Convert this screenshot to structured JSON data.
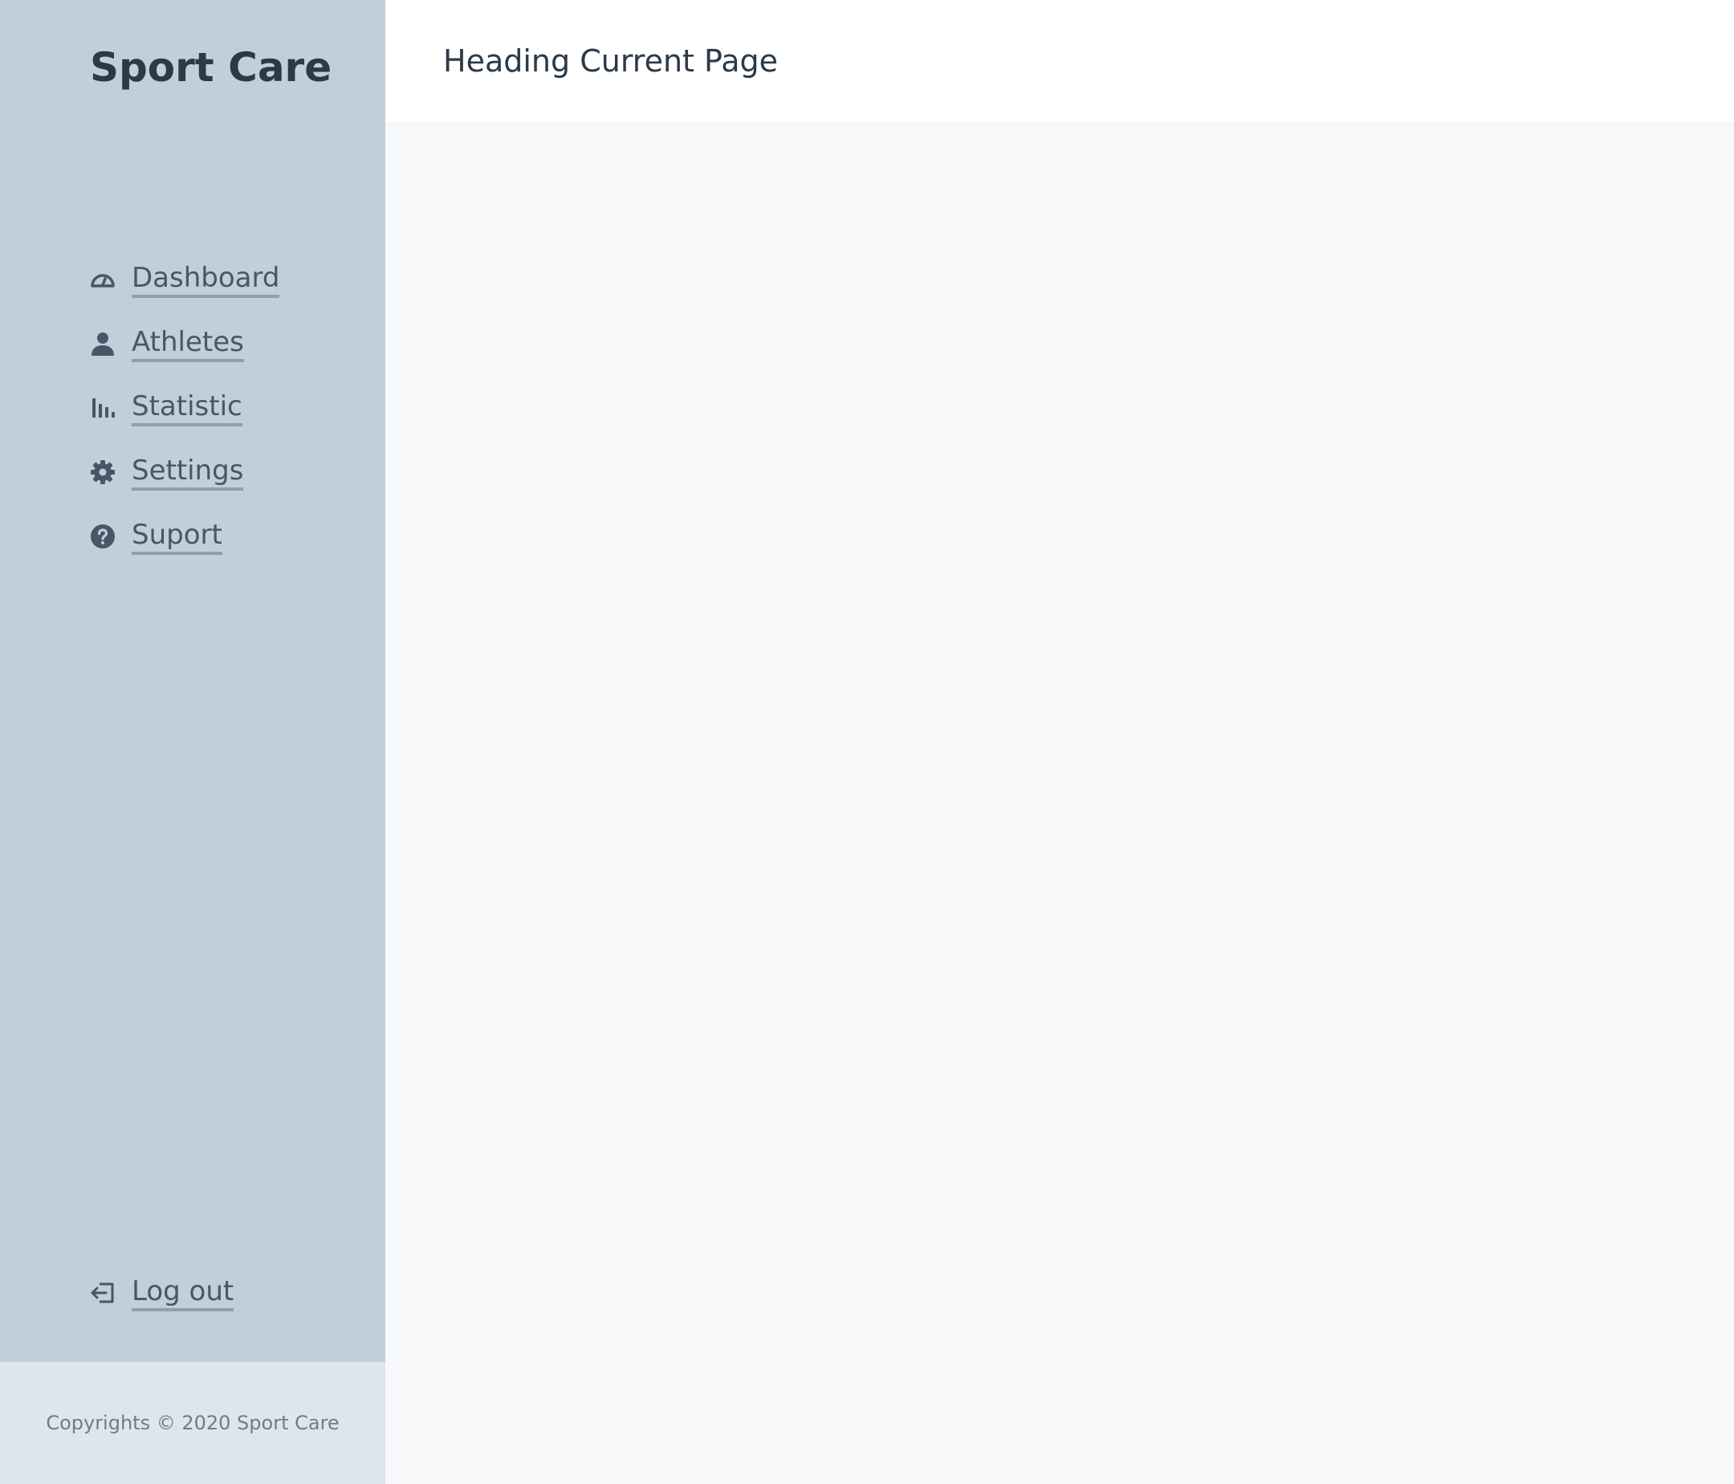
{
  "brand": {
    "name": "Sport Care"
  },
  "nav": {
    "items": [
      {
        "label": "Dashboard",
        "icon": "gauge-icon"
      },
      {
        "label": "Athletes",
        "icon": "user-icon"
      },
      {
        "label": "Statistic",
        "icon": "bar-chart-icon"
      },
      {
        "label": "Settings",
        "icon": "gear-icon"
      },
      {
        "label": "Suport",
        "icon": "question-circle-icon"
      }
    ],
    "logout": {
      "label": "Log out",
      "icon": "logout-icon"
    }
  },
  "header": {
    "title": "Heading Current Page"
  },
  "footer": {
    "copyright": "Copyrights © 2020 Sport Care"
  },
  "colors": {
    "sidebar_bg": "#c2cfd8",
    "sidebar_footer_bg": "#dee5ec",
    "header_bg": "#ffffff",
    "content_bg": "#f7f8fa",
    "text_dark": "#2b3a48",
    "nav_text": "#475767",
    "nav_underline": "#8f9fae"
  }
}
